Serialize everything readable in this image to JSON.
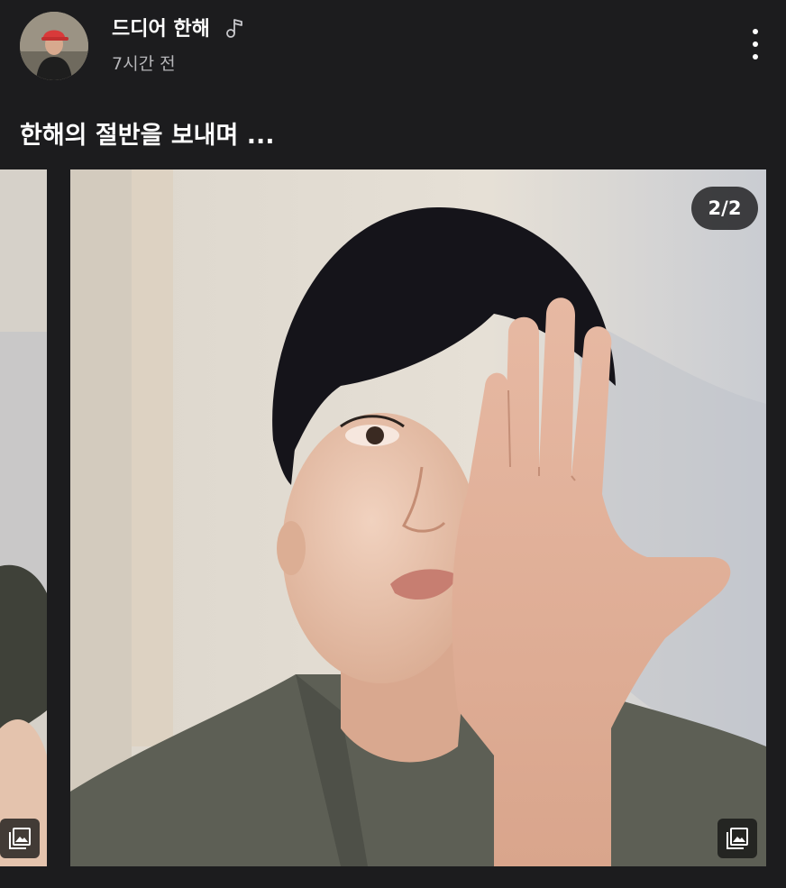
{
  "post": {
    "author": "드디어 한해",
    "author_icon": "music-note-icon",
    "timestamp": "7시간 전",
    "more_icon": "more-vertical-icon",
    "caption": "한해의 절반을 보내며 ..."
  },
  "carousel": {
    "counter": "2/2",
    "current_index": 2,
    "total": 2,
    "slide_type_icon": "photo-gallery-icon"
  },
  "colors": {
    "background": "#1c1c1e",
    "text_primary": "#ffffff",
    "text_secondary": "#b5b5b8",
    "badge_bg": "#1c1c1e"
  }
}
